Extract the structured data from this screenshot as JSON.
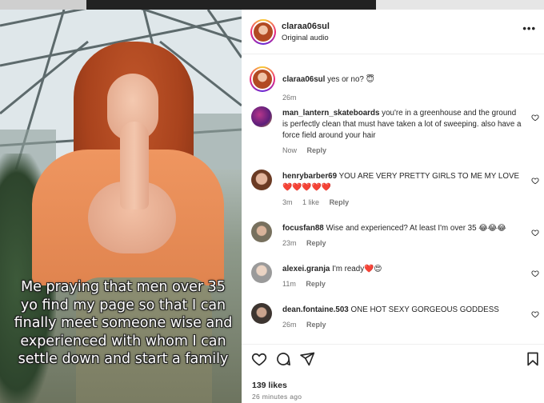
{
  "post": {
    "caption_overlay": "Me praying that men over 35 yo find my page so that I can finally meet someone wise and experienced with whom I can settle down and start a family"
  },
  "header": {
    "username": "claraa06sul",
    "subtitle": "Original audio",
    "more_icon": "more-horizontal-icon",
    "more_label": "•••"
  },
  "comments": [
    {
      "username": "claraa06sul",
      "text": "yes or no? 😇",
      "time": "26m",
      "likes": "",
      "reply": "",
      "is_caption": true
    },
    {
      "username": "man_lantern_skateboards",
      "text": "you're in a greenhouse and the ground is perfectly clean that must have taken a lot of sweeping. also have a force field around your hair",
      "time": "Now",
      "likes": "",
      "reply": "Reply"
    },
    {
      "username": "henrybarber69",
      "text": "YOU ARE VERY PRETTY GIRLS TO ME MY LOVE ❤️❤️❤️❤️❤️",
      "time": "3m",
      "likes": "1 like",
      "reply": "Reply"
    },
    {
      "username": "focusfan88",
      "text": "Wise and experienced? At least I'm over 35 😂😂😂",
      "time": "23m",
      "likes": "",
      "reply": "Reply"
    },
    {
      "username": "alexei.granja",
      "text": "I'm ready❤️😍",
      "time": "11m",
      "likes": "",
      "reply": "Reply"
    },
    {
      "username": "dean.fontaine.503",
      "text": "ONE HOT SEXY GORGEOUS GODDESS",
      "time": "26m",
      "likes": "",
      "reply": "Reply"
    }
  ],
  "actions": {
    "like_icon": "heart-icon",
    "comment_icon": "comment-icon",
    "share_icon": "send-icon",
    "save_icon": "bookmark-icon",
    "likes": "139 likes",
    "posted": "26 minutes ago"
  },
  "colors": {
    "text": "#262626",
    "muted": "#737373",
    "divider": "#efefef"
  }
}
